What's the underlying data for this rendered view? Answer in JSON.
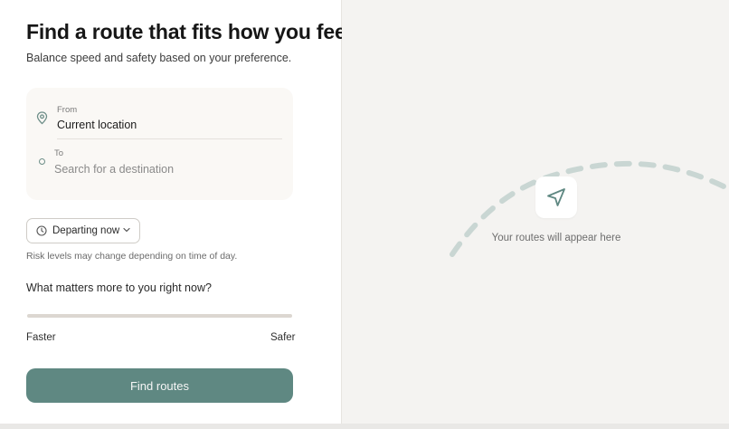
{
  "header": {
    "title": "Find a route that fits how you feel",
    "subtitle": "Balance speed and safety based on your preference."
  },
  "route": {
    "from_label": "From",
    "from_value": "Current location",
    "to_label": "To",
    "to_placeholder": "Search for a destination",
    "to_value": ""
  },
  "departure": {
    "selected": "Departing now",
    "note": "Risk levels may change depending on time of day."
  },
  "preference": {
    "question": "What matters more to you right now?",
    "left_label": "Faster",
    "right_label": "Safer"
  },
  "actions": {
    "find_routes": "Find routes"
  },
  "empty_state": {
    "message": "Your routes will appear here",
    "icon": "navigation-arrow-icon"
  },
  "colors": {
    "accent": "#5f8882",
    "card_background": "#faf8f5",
    "arc": "#c9d6d3",
    "panel_background": "#f4f3f1"
  }
}
